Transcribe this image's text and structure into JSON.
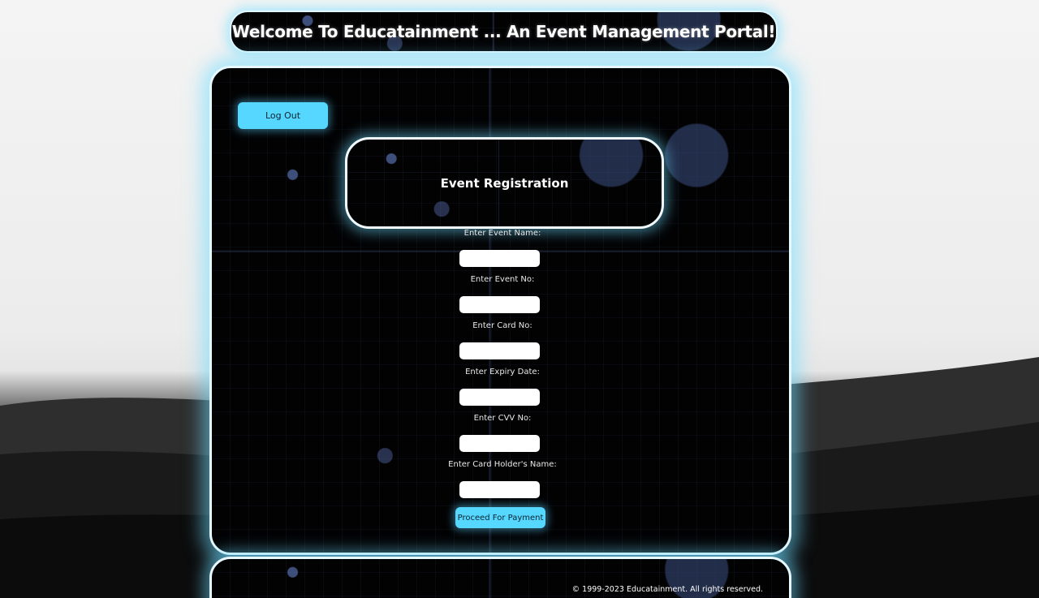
{
  "header": {
    "title": "Welcome To Educatainment ... An Event Management Portal!"
  },
  "main": {
    "logout_label": "Log Out",
    "card_title": "Event Registration",
    "form": {
      "event_name_label": "Enter Event Name:",
      "event_no_label": "Enter Event No:",
      "card_no_label": "Enter Card No:",
      "expiry_label": "Enter Expiry Date:",
      "cvv_label": "Enter CVV No:",
      "holder_label": "Enter Card Holder's Name:",
      "event_name_value": "",
      "event_no_value": "",
      "card_no_value": "",
      "expiry_value": "",
      "cvv_value": "",
      "holder_value": "",
      "submit_label": "Proceed For Payment"
    }
  },
  "footer": {
    "copyright": "© 1999-2023 Educatainment. All rights reserved."
  },
  "colors": {
    "accent": "#56d7ff",
    "glow": "#6edcff",
    "panel": "#020203"
  }
}
